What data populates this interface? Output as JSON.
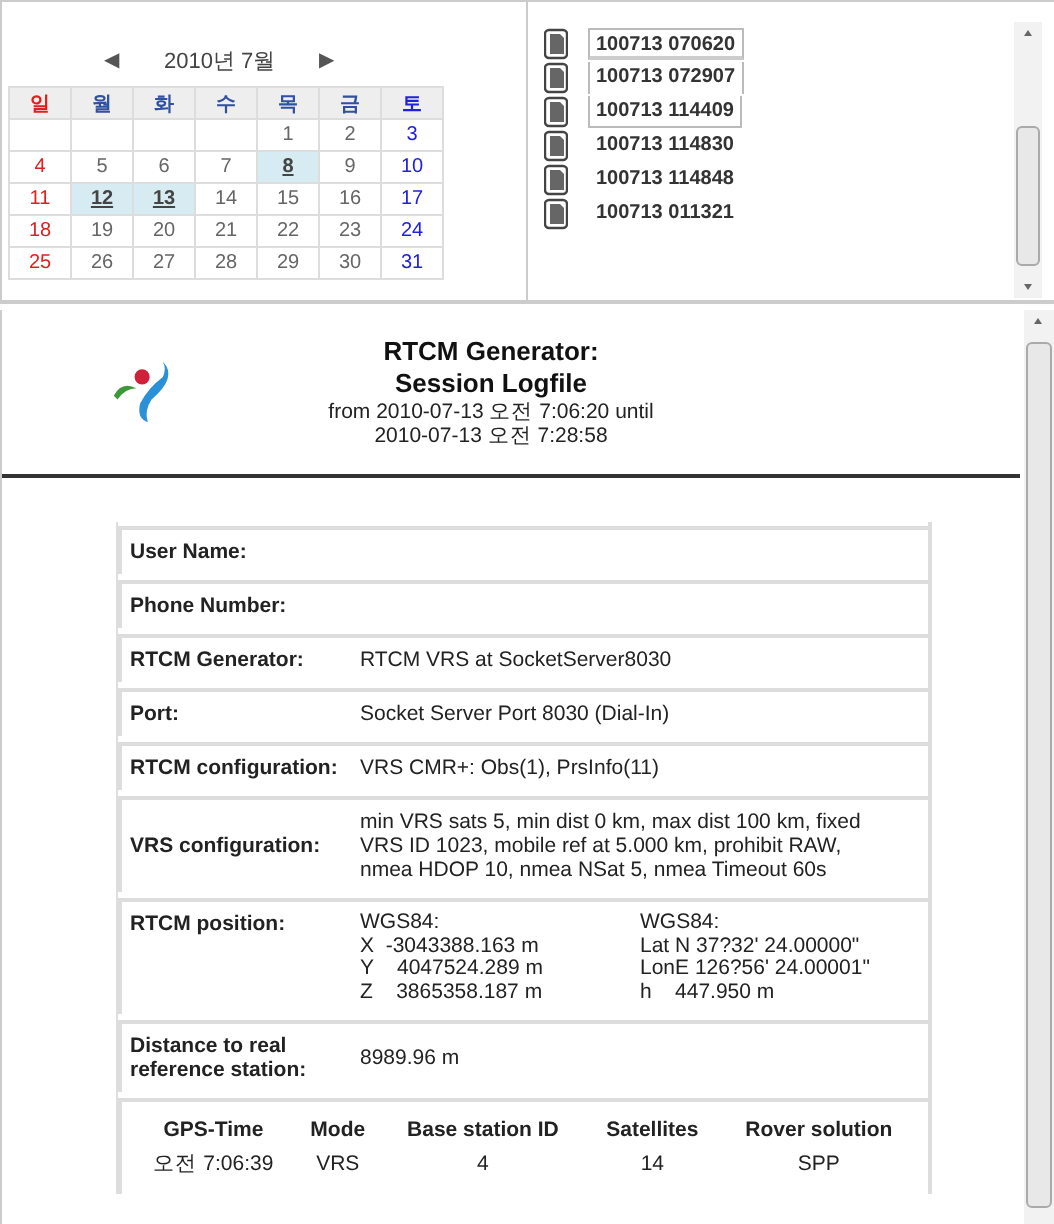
{
  "calendar": {
    "prev": "◀",
    "month": "2010년 7월",
    "next": "▶",
    "headers": [
      {
        "label": "일",
        "kind": "sunday"
      },
      {
        "label": "월",
        "kind": "weekday"
      },
      {
        "label": "화",
        "kind": "weekday"
      },
      {
        "label": "수",
        "kind": "weekday"
      },
      {
        "label": "목",
        "kind": "weekday"
      },
      {
        "label": "금",
        "kind": "weekday"
      },
      {
        "label": "토",
        "kind": "saturday"
      }
    ],
    "weeks": [
      [
        {
          "blank": true
        },
        {
          "blank": true
        },
        {
          "blank": true
        },
        {
          "blank": true
        },
        {
          "day": "1",
          "linked": false
        },
        {
          "day": "2",
          "linked": false
        },
        {
          "day": "3",
          "linked": false
        }
      ],
      [
        {
          "day": "4",
          "linked": false
        },
        {
          "day": "5",
          "linked": false
        },
        {
          "day": "6",
          "linked": false
        },
        {
          "day": "7",
          "linked": false
        },
        {
          "day": "8",
          "linked": true
        },
        {
          "day": "9",
          "linked": false
        },
        {
          "day": "10",
          "linked": false
        }
      ],
      [
        {
          "day": "11",
          "linked": false
        },
        {
          "day": "12",
          "linked": true
        },
        {
          "day": "13",
          "linked": true
        },
        {
          "day": "14",
          "linked": false
        },
        {
          "day": "15",
          "linked": false
        },
        {
          "day": "16",
          "linked": false
        },
        {
          "day": "17",
          "linked": false
        }
      ],
      [
        {
          "day": "18",
          "linked": false
        },
        {
          "day": "19",
          "linked": false
        },
        {
          "day": "20",
          "linked": false
        },
        {
          "day": "21",
          "linked": false
        },
        {
          "day": "22",
          "linked": false
        },
        {
          "day": "23",
          "linked": false
        },
        {
          "day": "24",
          "linked": false
        }
      ],
      [
        {
          "day": "25",
          "linked": false
        },
        {
          "day": "26",
          "linked": false
        },
        {
          "day": "27",
          "linked": false
        },
        {
          "day": "28",
          "linked": false
        },
        {
          "day": "29",
          "linked": false
        },
        {
          "day": "30",
          "linked": false
        },
        {
          "day": "31",
          "linked": false
        }
      ]
    ]
  },
  "files": [
    {
      "name": "100713 070620",
      "selected": true
    },
    {
      "name": "100713 072907",
      "selected": true
    },
    {
      "name": "100713 114409",
      "selected": true
    },
    {
      "name": "100713 114830",
      "selected": false
    },
    {
      "name": "100713 114848",
      "selected": false
    },
    {
      "name": "100713 011321",
      "selected": false
    }
  ],
  "report": {
    "title": [
      "RTCM Generator:",
      "Session Logfile"
    ],
    "period": [
      "from 2010-07-13 오전 7:06:20 until",
      "2010-07-13 오전 7:28:58"
    ],
    "rows": [
      {
        "kind": "field",
        "label": "User Name:"
      },
      {
        "kind": "field",
        "label": "Phone Number:"
      },
      {
        "kind": "field",
        "label": "RTCM Generator:",
        "value": "RTCM VRS at SocketServer8030"
      },
      {
        "kind": "field",
        "label": "Port:",
        "value": "Socket Server Port 8030 (Dial-In)"
      },
      {
        "kind": "field",
        "label": "RTCM configuration:",
        "value": "VRS CMR+: Obs(1), PrsInfo(11)"
      },
      {
        "kind": "field",
        "label": "VRS configuration:",
        "value": "min VRS sats 5, min dist 0 km, max dist 100 km, fixed VRS ID 1023, mobile ref at 5.000 km, prohibit RAW, nmea HDOP 10, nmea NSat 5, nmea Timeout 60s"
      },
      {
        "kind": "position",
        "label": "RTCM position:",
        "columns": [
          [
            "WGS84:",
            "X  -3043388.163 m",
            "Y    4047524.289 m",
            "Z    3865358.187 m"
          ],
          [
            "WGS84:",
            "Lat N 37?32' 24.00000\"",
            "LonE 126?56' 24.00001\"",
            "h    447.950 m"
          ]
        ]
      },
      {
        "kind": "field",
        "label": "Distance to real reference station:",
        "value": "8989.96 m"
      }
    ],
    "session": {
      "columns": [
        "GPS-Time",
        "Mode",
        "Base station ID",
        "Satellites",
        "Rover solution"
      ],
      "rows": [
        [
          "오전 7:06:39",
          "VRS",
          "4",
          "14",
          "SPP"
        ]
      ]
    }
  }
}
